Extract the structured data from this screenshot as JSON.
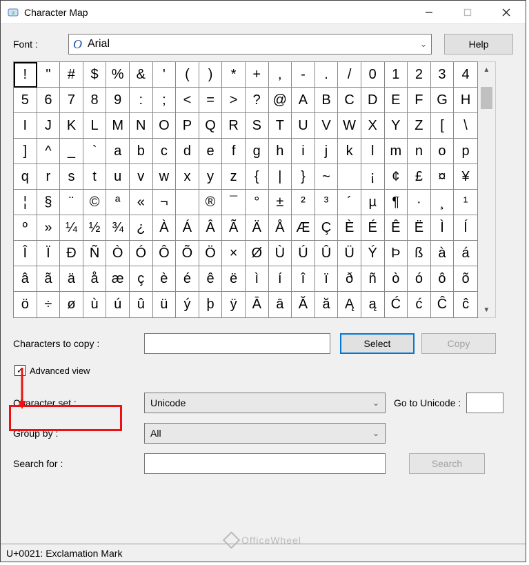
{
  "window": {
    "title": "Character Map"
  },
  "font_row": {
    "label": "Font :",
    "value": "Arial",
    "help_btn": "Help"
  },
  "grid": {
    "selected_index": 0,
    "chars": [
      "!",
      "\"",
      "#",
      "$",
      "%",
      "&",
      "'",
      "(",
      ")",
      "*",
      "+",
      ",",
      "-",
      ".",
      "/",
      "0",
      "1",
      "2",
      "3",
      "4",
      "5",
      "6",
      "7",
      "8",
      "9",
      ":",
      ";",
      "<",
      "=",
      ">",
      "?",
      "@",
      "A",
      "B",
      "C",
      "D",
      "E",
      "F",
      "G",
      "H",
      "I",
      "J",
      "K",
      "L",
      "M",
      "N",
      "O",
      "P",
      "Q",
      "R",
      "S",
      "T",
      "U",
      "V",
      "W",
      "X",
      "Y",
      "Z",
      "[",
      "\\",
      "]",
      "^",
      "_",
      "`",
      "a",
      "b",
      "c",
      "d",
      "e",
      "f",
      "g",
      "h",
      "i",
      "j",
      "k",
      "l",
      "m",
      "n",
      "o",
      "p",
      "q",
      "r",
      "s",
      "t",
      "u",
      "v",
      "w",
      "x",
      "y",
      "z",
      "{",
      "|",
      "}",
      "~",
      "",
      "¡",
      "¢",
      "£",
      "¤",
      "¥",
      "¦",
      "§",
      "¨",
      "©",
      "ª",
      "«",
      "¬",
      "",
      "®",
      "¯",
      "°",
      "±",
      "²",
      "³",
      "´",
      "µ",
      "¶",
      "·",
      "¸",
      "¹",
      "º",
      "»",
      "¼",
      "½",
      "¾",
      "¿",
      "À",
      "Á",
      "Â",
      "Ã",
      "Ä",
      "Å",
      "Æ",
      "Ç",
      "È",
      "É",
      "Ê",
      "Ë",
      "Ì",
      "Í",
      "Î",
      "Ï",
      "Ð",
      "Ñ",
      "Ò",
      "Ó",
      "Ô",
      "Õ",
      "Ö",
      "×",
      "Ø",
      "Ù",
      "Ú",
      "Û",
      "Ü",
      "Ý",
      "Þ",
      "ß",
      "à",
      "á",
      "â",
      "ã",
      "ä",
      "å",
      "æ",
      "ç",
      "è",
      "é",
      "ê",
      "ë",
      "ì",
      "í",
      "î",
      "ï",
      "ð",
      "ñ",
      "ò",
      "ó",
      "ô",
      "õ",
      "ö",
      "÷",
      "ø",
      "ù",
      "ú",
      "û",
      "ü",
      "ý",
      "þ",
      "ÿ",
      "Ā",
      "ā",
      "Ă",
      "ă",
      "Ą",
      "ą",
      "Ć",
      "ć",
      "Ĉ",
      "ĉ"
    ]
  },
  "copy_row": {
    "label": "Characters to copy :",
    "value": "",
    "select_btn": "Select",
    "copy_btn": "Copy"
  },
  "advanced": {
    "checkbox_label": "Advanced view",
    "checked": true,
    "charset_label": "Character set :",
    "charset_value": "Unicode",
    "goto_label": "Go to Unicode :",
    "goto_value": "",
    "groupby_label": "Group by :",
    "groupby_value": "All",
    "search_label": "Search for :",
    "search_value": "",
    "search_btn": "Search"
  },
  "statusbar": "U+0021: Exclamation Mark",
  "watermark": "OfficeWheel"
}
